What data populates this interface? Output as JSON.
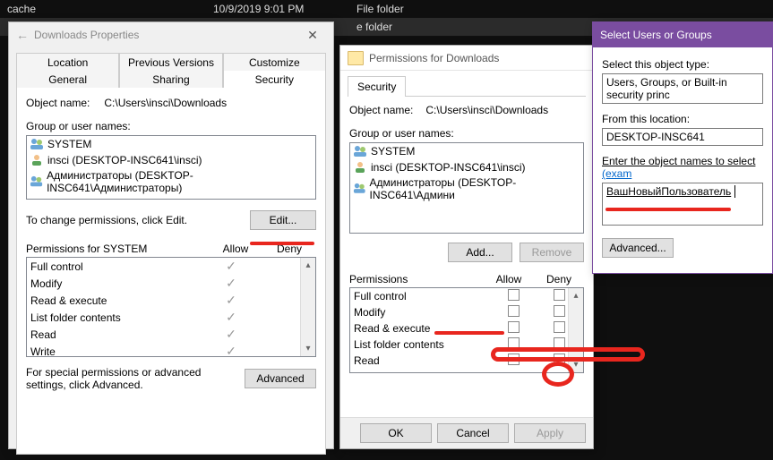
{
  "explorer": {
    "row1": {
      "name": "cache",
      "date": "10/9/2019 9:01 PM",
      "type": "File folder"
    },
    "row2_type": "e folder"
  },
  "props": {
    "title": "Downloads Properties",
    "tabs": [
      "Location",
      "Previous Versions",
      "Customize",
      "General",
      "Sharing",
      "Security"
    ],
    "object_label": "Object name:",
    "object_value": "C:\\Users\\insci\\Downloads",
    "group_label": "Group or user names:",
    "users": [
      {
        "icon": "group",
        "name": "SYSTEM"
      },
      {
        "icon": "user",
        "name": "insci (DESKTOP-INSC641\\insci)"
      },
      {
        "icon": "group",
        "name": "Администраторы (DESKTOP-INSC641\\Администраторы)"
      }
    ],
    "change_text": "To change permissions, click Edit.",
    "edit_btn": "Edit...",
    "perm_for": "Permissions for SYSTEM",
    "allow": "Allow",
    "deny": "Deny",
    "perms": [
      "Full control",
      "Modify",
      "Read & execute",
      "List folder contents",
      "Read",
      "Write"
    ],
    "special_text": "For special permissions or advanced settings, click Advanced.",
    "advanced_btn": "Advanced"
  },
  "permeditor": {
    "title": "Permissions for Downloads",
    "tab": "Security",
    "object_label": "Object name:",
    "object_value": "C:\\Users\\insci\\Downloads",
    "group_label": "Group or user names:",
    "users": [
      {
        "icon": "group",
        "name": "SYSTEM"
      },
      {
        "icon": "user",
        "name": "insci (DESKTOP-INSC641\\insci)"
      },
      {
        "icon": "group",
        "name": "Администраторы (DESKTOP-INSC641\\Админи"
      }
    ],
    "add_btn": "Add...",
    "remove_btn": "Remove",
    "perm_label": "Permissions",
    "allow": "Allow",
    "deny": "Deny",
    "perms": [
      "Full control",
      "Modify",
      "Read & execute",
      "List folder contents",
      "Read"
    ],
    "ok": "OK",
    "cancel": "Cancel",
    "apply": "Apply"
  },
  "selusers": {
    "title": "Select Users or Groups",
    "obj_type_label": "Select this object type:",
    "obj_type_value": "Users, Groups, or Built-in security princ",
    "loc_label": "From this location:",
    "loc_value": "DESKTOP-INSC641",
    "names_label_a": "Enter the object names to select ",
    "names_label_b": "(exam",
    "names_value": "ВашНовыйПользователь",
    "advanced_btn": "Advanced..."
  }
}
